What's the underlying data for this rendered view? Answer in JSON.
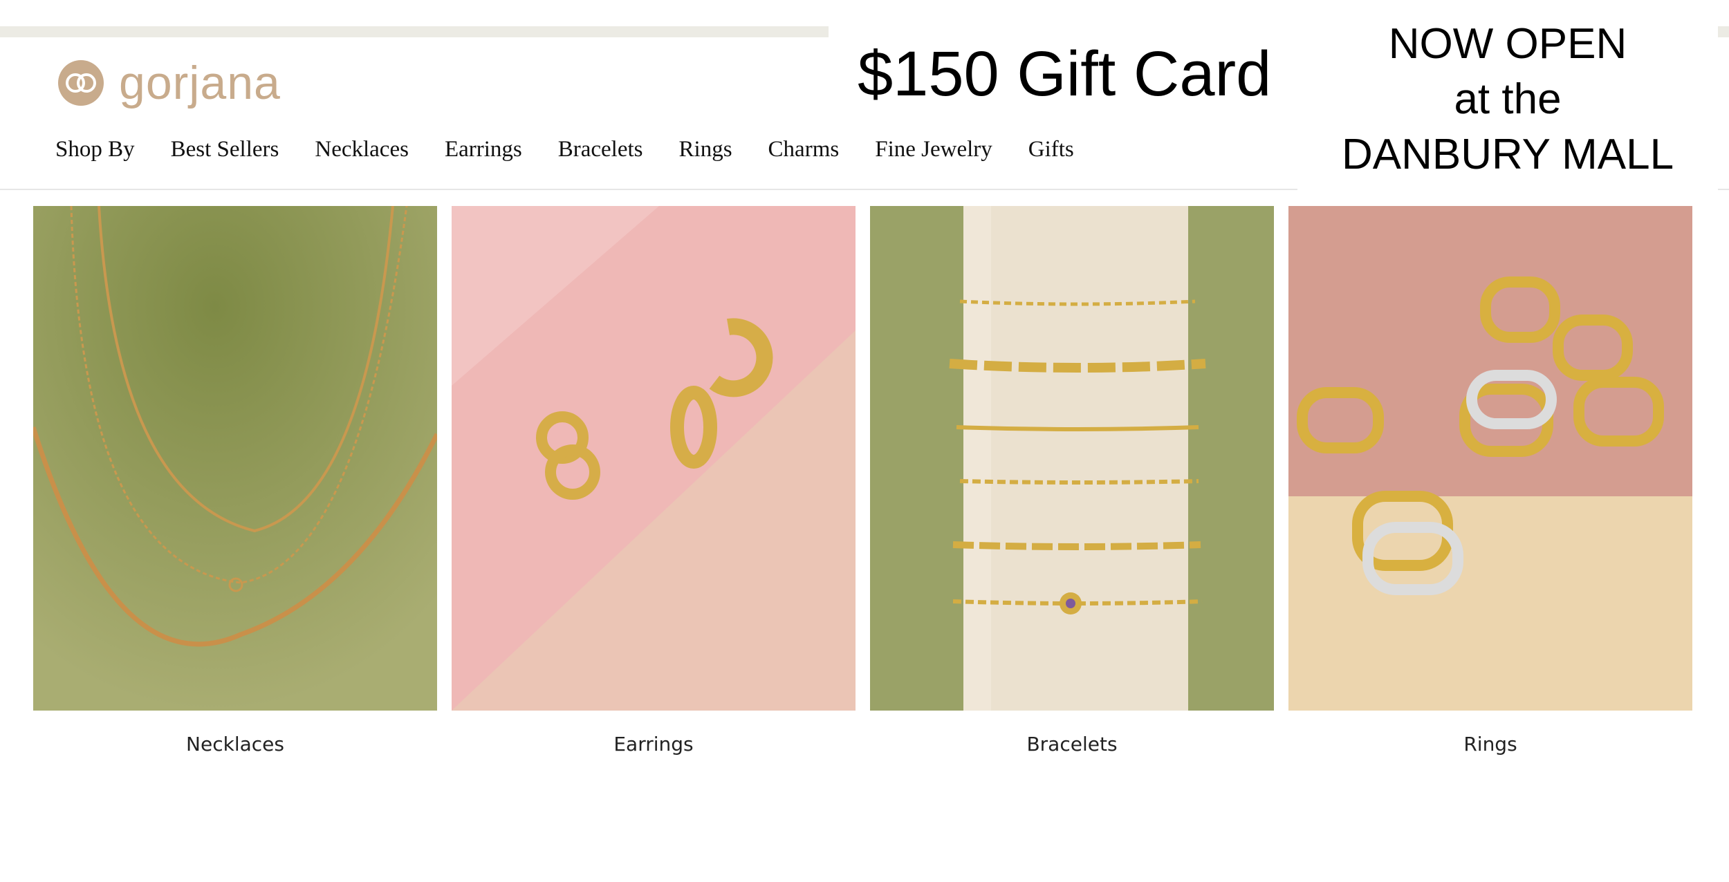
{
  "brand": {
    "logo_text": "gorjana",
    "logo_icon": "gg-monogram-icon"
  },
  "nav": {
    "items": [
      {
        "label": "Shop By"
      },
      {
        "label": "Best Sellers"
      },
      {
        "label": "Necklaces"
      },
      {
        "label": "Earrings"
      },
      {
        "label": "Bracelets"
      },
      {
        "label": "Rings"
      },
      {
        "label": "Charms"
      },
      {
        "label": "Fine Jewelry"
      },
      {
        "label": "Gifts"
      }
    ]
  },
  "promo": {
    "gift_card": "$150 Gift Card",
    "store_line1": "NOW OPEN",
    "store_line2": "at the",
    "store_line3": "DANBURY MALL"
  },
  "categories": [
    {
      "label": "Necklaces",
      "image": "necklaces-image"
    },
    {
      "label": "Earrings",
      "image": "earrings-image"
    },
    {
      "label": "Bracelets",
      "image": "bracelets-image"
    },
    {
      "label": "Rings",
      "image": "rings-image"
    }
  ],
  "colors": {
    "brand": "#c8ab8c",
    "olive_bg": "#9aa267",
    "pink_bg": "#e9b9b3",
    "gold": "#d7b14a"
  }
}
